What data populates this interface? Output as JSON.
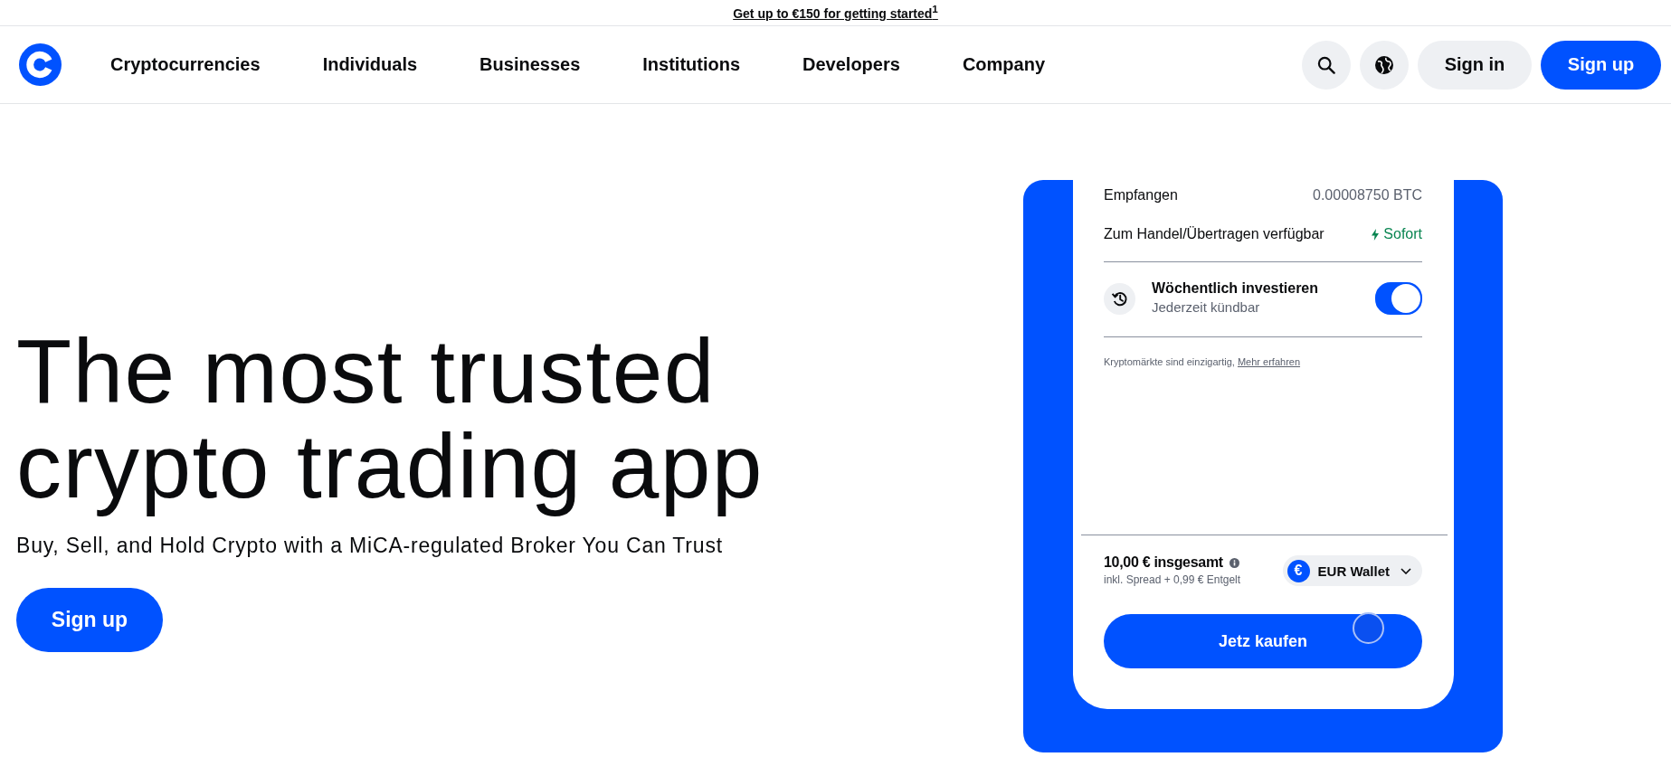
{
  "promo_banner": {
    "text": "Get up to €150 for getting started$^{1}$"
  },
  "nav": {
    "links": [
      {
        "label": "Cryptocurrencies"
      },
      {
        "label": "Individuals"
      },
      {
        "label": "Businesses"
      },
      {
        "label": "Institutions"
      },
      {
        "label": "Developers"
      },
      {
        "label": "Company"
      }
    ],
    "sign_in": "Sign in",
    "sign_up": "Sign up"
  },
  "hero": {
    "title": "The most trusted crypto trading app",
    "subtitle": "Buy, Sell, and Hold Crypto with a MiCA-regulated Broker You Can Trust",
    "cta": "Sign up"
  },
  "phone": {
    "rows": [
      {
        "kind": "amount",
        "label": "Empfangen",
        "value": "0.00008750 BTC"
      },
      {
        "kind": "instant",
        "label": "Zum Handel/Übertragen verfügbar",
        "value": "Sofort"
      }
    ],
    "recurring": {
      "title": "Wöchentlich investieren",
      "subtitle": "Jederzeit kündbar",
      "on": true
    },
    "disclaimer": {
      "text": "Kryptomärkte sind einzigartig,",
      "link": "Mehr erfahren"
    },
    "total": {
      "title": "10,00 € insgesamt",
      "note": "inkl. Spread + 0,99 € Entgelt"
    },
    "wallet": {
      "symbol": "€",
      "label": "EUR Wallet"
    },
    "buy_button": "Jetz kaufen"
  }
}
